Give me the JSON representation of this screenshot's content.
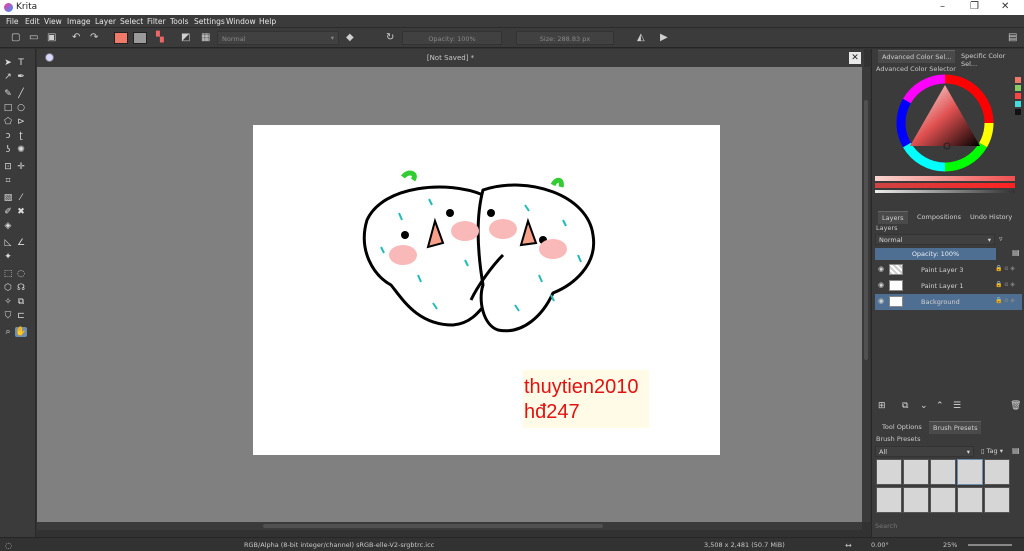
{
  "app": {
    "title": "Krita"
  },
  "menu": [
    "File",
    "Edit",
    "View",
    "Image",
    "Layer",
    "Select",
    "Filter",
    "Tools",
    "Settings",
    "Window",
    "Help"
  ],
  "toolbar": {
    "blend_mode": "Normal",
    "opacity": "Opacity: 100%",
    "size": "Size: 288.83 px"
  },
  "document": {
    "name": "[Not Saved]",
    "modified_mark": "*"
  },
  "canvas_text": {
    "line1": "thuytien2010",
    "line2": "hđ247"
  },
  "dock": {
    "color_tabs": [
      "Advanced Color Sel...",
      "Specific Color Sel..."
    ],
    "color_title": "Advanced Color Selector",
    "layer_tabs": [
      "Layers",
      "Compositions",
      "Undo History"
    ],
    "layers_title": "Layers",
    "blend_mode": "Normal",
    "opacity": "Opacity:  100%",
    "layers": [
      "Paint Layer 3",
      "Paint Layer 1",
      "Background"
    ],
    "tool_tabs": [
      "Tool Options",
      "Brush Presets"
    ],
    "presets_title": "Brush Presets",
    "preset_filter": "All",
    "tag_label": "Tag",
    "search_placeholder": "Search"
  },
  "status": {
    "colorspace": "RGB/Alpha (8-bit integer/channel)  sRGB-elle-V2-srgbtrc.icc",
    "dimensions": "3,508 x 2,481 (50.7 MiB)",
    "rotation": "0.00°",
    "zoom": "25%"
  },
  "colors": {
    "accent": "#4f6f92",
    "fg": "#f07a6a",
    "bg": "#9a9a9a"
  }
}
